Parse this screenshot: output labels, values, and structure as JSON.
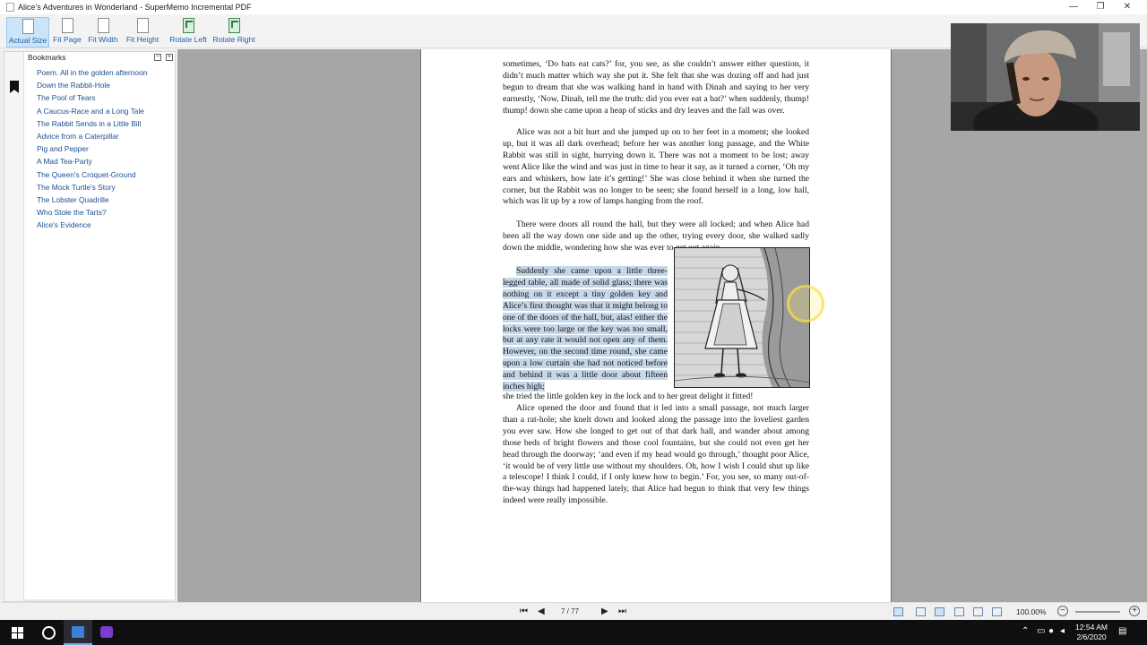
{
  "window": {
    "title": "Alice's Adventures in Wonderland - SuperMemo Incremental PDF",
    "minimize": "—",
    "maximize": "❐",
    "close": "✕"
  },
  "toolbar": {
    "buttons": [
      {
        "label": "Actual Size",
        "active": true
      },
      {
        "label": "Fit Page"
      },
      {
        "label": "Fit Width"
      },
      {
        "label": "Fit Height"
      },
      {
        "label": "Rotate Left"
      },
      {
        "label": "Rotate Right"
      }
    ]
  },
  "bookmarks": {
    "header": "Bookmarks",
    "collapse": "−",
    "expand": "+",
    "items": [
      "Poem. All in the golden afternoon",
      "Down the Rabbit-Hole",
      "The Pool of Tears",
      "A Caucus-Race and a Long Tale",
      "The Rabbit Sends in a Little Bill",
      "Advice from a Caterpillar",
      "Pig and Pepper",
      "A Mad Tea-Party",
      "The Queen's Croquet-Ground",
      "The Mock Turtle's Story",
      "The Lobster Quadrille",
      "Who Stole the Tarts?",
      "Alice's Evidence"
    ]
  },
  "page": {
    "p1": "sometimes, ‘Do bats eat cats?’ for, you see, as she couldn’t answer either question, it didn’t much matter which way she put it. She felt that she was dozing off and had just begun to dream that she was walking hand in hand with Dinah and saying to her very earnestly, ‘Now, Dinah, tell me the truth: did you ever eat a bat?’ when suddenly, thump! thump! down she came upon a heap of sticks and dry leaves and the fall was over.",
    "p2": "Alice was not a bit hurt and she jumped up on to her feet in a moment; she looked up, but it was all dark overhead; before her was another long passage, and the White Rabbit was still in sight, hurrying down it. There was not a moment to be lost; away went Alice like the wind and was just in time to hear it say, as it turned a corner, ‘Oh my ears and whiskers, how late it’s getting!’ She was close behind it when she turned the corner, but the Rabbit was no longer to be seen; she found herself in a long, low hall, which was lit up by a row of lamps hanging from the roof.",
    "p3": "There were doors all round the hall, but they were all locked; and when Alice had been all the way down one side and up the other, trying every door, she walked sadly down the middle, wondering how she was ever to get out again.",
    "p4_highlight": "Suddenly she came upon a little three-legged table, all made of solid glass; there was nothing on it except a tiny golden key and Alice’s first thought was that it might belong to one of the doors of the hall, but, alas! either the locks were too large or the key was too small, but at any rate it would not open any of them. However, on the second time round, she came upon a low curtain she had not noticed before and behind it was a little door about fifteen inches high;",
    "p4_rest": "she tried the little golden key in the lock and to her great delight it fitted!",
    "p5": "Alice opened the door and found that it led into a small passage, not much larger than a rat-hole; she knelt down and looked along the passage into the loveliest garden you ever saw. How she longed to get out of that dark hall, and wander about among those beds of bright flowers and those cool fountains, but she could not even get her head through the doorway; ‘and even if my head would go through,’ thought poor Alice, ‘it would be of very little use without my shoulders. Oh, how I wish I could shut up like a telescope! I think I could, if I only knew how to begin.’ For, you see, so many out-of-the-way things had happened lately, that Alice had begun to think that very few things indeed were really impossible."
  },
  "statusbar": {
    "page_indicator": "7 / 77",
    "zoom": "100.00%"
  },
  "taskbar": {
    "time": "12:54 AM",
    "date": "2/6/2020"
  },
  "colors": {
    "highlight": "#c6d7ea",
    "link": "#1d4f91",
    "accent": "#1e5fa8"
  }
}
